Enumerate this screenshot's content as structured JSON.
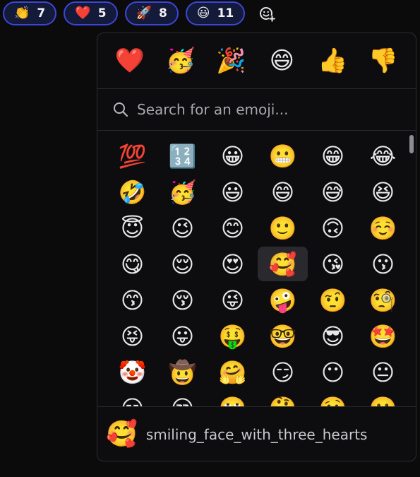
{
  "reactions": [
    {
      "emoji": "👏",
      "count": "7"
    },
    {
      "emoji": "❤️",
      "count": "5"
    },
    {
      "emoji": "🚀",
      "count": "8"
    },
    {
      "emoji": "😃",
      "count": "11"
    }
  ],
  "add_reaction_icon": "add-emoji-icon",
  "accent_color": "#3b46d8",
  "picker": {
    "quick": [
      "❤️",
      "🥳",
      "🎉",
      "😄",
      "👍",
      "👎"
    ],
    "search_placeholder": "Search for an emoji...",
    "grid": [
      "💯",
      "🔢",
      "😀",
      "😬",
      "😁",
      "😂",
      "🤣",
      "🥳",
      "😃",
      "😄",
      "😅",
      "😆",
      "😇",
      "😉",
      "😊",
      "🙂",
      "🙃",
      "☺️",
      "😋",
      "😌",
      "😍",
      "🥰",
      "😘",
      "😗",
      "😙",
      "😚",
      "😜",
      "🤪",
      "🤨",
      "🧐",
      "😝",
      "😛",
      "🤑",
      "🤓",
      "😎",
      "🤩",
      "🤡",
      "🤠",
      "🤗",
      "😏",
      "😶",
      "😐",
      "😑",
      "😒",
      "🙄",
      "🤔",
      "🤥",
      "😬"
    ],
    "highlighted_index": 21,
    "preview": {
      "emoji": "🥰",
      "name": "smiling_face_with_three_hearts"
    }
  }
}
